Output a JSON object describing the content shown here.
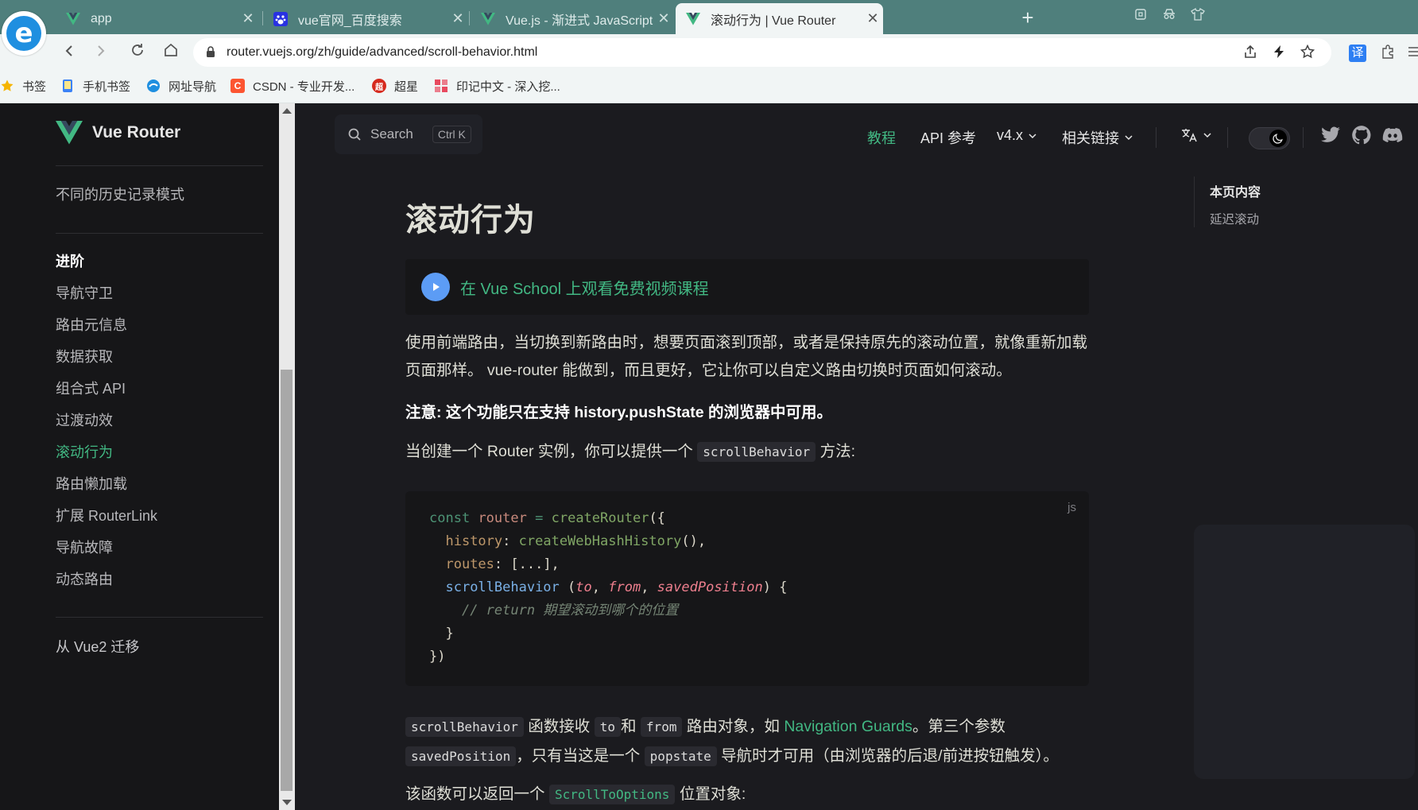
{
  "browser": {
    "tabs": [
      {
        "title": "app",
        "close": "✕"
      },
      {
        "title": "vue官网_百度搜索",
        "close": "✕"
      },
      {
        "title": "Vue.js - 渐进式 JavaScript 框架",
        "close": "✕"
      },
      {
        "title": "滚动行为 | Vue Router",
        "close": "✕"
      }
    ],
    "new_tab": "+",
    "url": "router.vuejs.org/zh/guide/advanced/scroll-behavior.html",
    "translate_badge": "译",
    "bookmarks": [
      {
        "label": "书签",
        "icon": "star-icon"
      },
      {
        "label": "手机书签",
        "icon": "phone-bookmark-icon"
      },
      {
        "label": "网址导航",
        "icon": "nav-icon"
      },
      {
        "label": "CSDN - 专业开发...",
        "icon": "csdn-icon",
        "glyph": "C"
      },
      {
        "label": "超星",
        "icon": "chaoxing-icon",
        "glyph": "超"
      },
      {
        "label": "印记中文 - 深入挖...",
        "icon": "docschina-icon"
      }
    ],
    "colors": {
      "tabbar": "#4f7f7c",
      "chrome": "#f1f5f5"
    }
  },
  "sidebar": {
    "brand": "Vue Router",
    "top_link": "不同的历史记录模式",
    "section_heading": "进阶",
    "items": [
      {
        "label": "导航守卫"
      },
      {
        "label": "路由元信息"
      },
      {
        "label": "数据获取"
      },
      {
        "label": "组合式 API"
      },
      {
        "label": "过渡动效"
      },
      {
        "label": "滚动行为"
      },
      {
        "label": "路由懒加载"
      },
      {
        "label": "扩展 RouterLink"
      },
      {
        "label": "导航故障"
      },
      {
        "label": "动态路由"
      }
    ],
    "active_index": 5,
    "bottom_link": "从 Vue2 迁移"
  },
  "nav": {
    "search_label": "Search",
    "search_kbd": "Ctrl K",
    "links": [
      "教程",
      "API 参考",
      "v4.x",
      "相关链接"
    ],
    "language_icon": "translate-icon",
    "accent": "#42b883"
  },
  "content": {
    "title": "滚动行为",
    "vueschool": "在 Vue School 上观看免费视频课程",
    "p1": "使用前端路由，当切换到新路由时，想要页面滚到顶部，或者是保持原先的滚动位置，就像重新加载页面那样。 vue-router 能做到，而且更好，它让你可以自定义路由切换时页面如何滚动。",
    "note": "注意: 这个功能只在支持 history.pushState 的浏览器中可用。",
    "p2_before": "当创建一个 Router 实例，你可以提供一个",
    "p2_code": "scrollBehavior",
    "p2_after": "方法:",
    "code_lang": "js",
    "code": {
      "l1_const": "const",
      "l1_router": "router",
      "l1_eq": "=",
      "l1_fn": "createRouter",
      "l1_end": "({",
      "l2_prop": "history",
      "l2_colon": ":",
      "l2_fn": "createWebHashHistory",
      "l2_end": "(),",
      "l3_prop": "routes",
      "l3_rest": ": [...],",
      "l4_fn": "scrollBehavior",
      "l4_open": " (",
      "l4_a": "to",
      "l4_c1": ", ",
      "l4_b": "from",
      "l4_c2": ", ",
      "l4_c": "savedPosition",
      "l4_close": ") {",
      "l5_comment": "// return 期望滚动到哪个的位置",
      "l6": "}",
      "l7": "})"
    },
    "p3": {
      "code1": "scrollBehavior",
      "t1": "函数接收",
      "code2": "to",
      "t2": "和",
      "code3": "from",
      "t3": "路由对象，如",
      "link": "Navigation Guards",
      "t4": "。第三个参数",
      "code4": "savedPosition",
      "t5": "，只有当这是一个",
      "code5": "popstate",
      "t6": "导航时才可用（由浏览器的后退/前进按钮触发）。"
    },
    "p4_before": "该函数可以返回一个",
    "p4_code": "ScrollToOptions",
    "p4_after": "位置对象:"
  },
  "outline": {
    "title": "本页内容",
    "items": [
      "延迟滚动"
    ]
  }
}
